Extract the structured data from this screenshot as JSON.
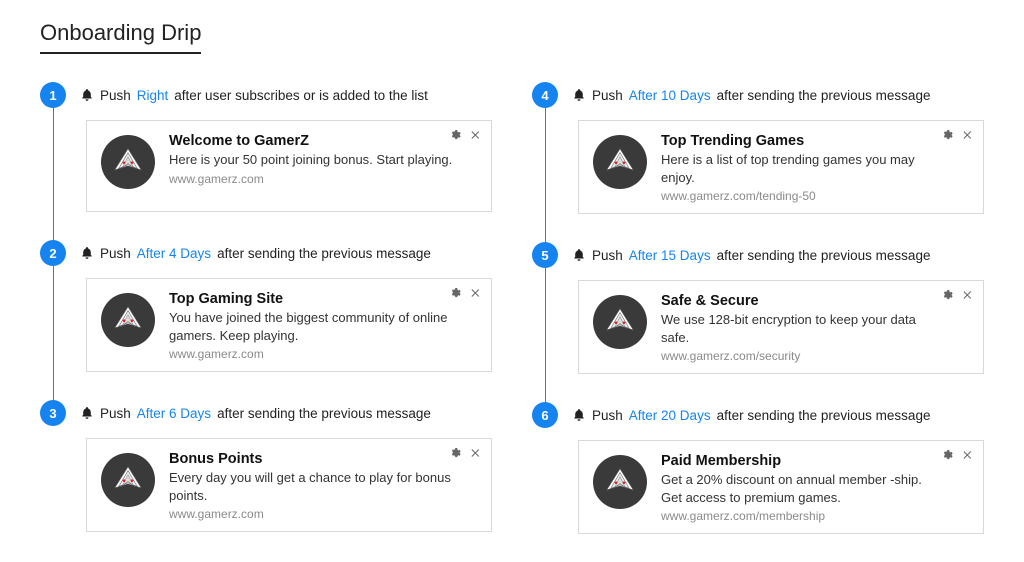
{
  "title": "Onboarding Drip",
  "push_label": "Push",
  "after_sending_suffix": "after sending the previous message",
  "steps": [
    {
      "num": "1",
      "timing": "Right",
      "suffix": "after user subscribes or is added to the list",
      "card": {
        "title": "Welcome to GamerZ",
        "desc": "Here is your 50 point joining bonus. Start playing.",
        "url": "www.gamerz.com"
      }
    },
    {
      "num": "2",
      "timing": "After 4 Days",
      "suffix": "after sending the previous message",
      "card": {
        "title": "Top Gaming Site",
        "desc": "You have joined the biggest community of online gamers. Keep playing.",
        "url": "www.gamerz.com"
      }
    },
    {
      "num": "3",
      "timing": "After 6 Days",
      "suffix": "after sending the previous message",
      "card": {
        "title": "Bonus Points",
        "desc": "Every day you will get a chance to play for bonus points.",
        "url": "www.gamerz.com"
      }
    },
    {
      "num": "4",
      "timing": "After 10 Days",
      "suffix": "after sending the previous message",
      "card": {
        "title": "Top Trending Games",
        "desc": "Here is a list of top trending games you may enjoy.",
        "url": "www.gamerz.com/tending-50"
      }
    },
    {
      "num": "5",
      "timing": "After 15 Days",
      "suffix": "after sending the previous message",
      "card": {
        "title": "Safe & Secure",
        "desc": "We use 128-bit encryption to keep your data safe.",
        "url": "www.gamerz.com/security"
      }
    },
    {
      "num": "6",
      "timing": "After 20 Days",
      "suffix": "after sending the previous message",
      "card": {
        "title": "Paid Membership",
        "desc": "Get a 20% discount on annual member -ship. Get access to premium games.",
        "url": "www.gamerz.com/membership"
      }
    }
  ]
}
